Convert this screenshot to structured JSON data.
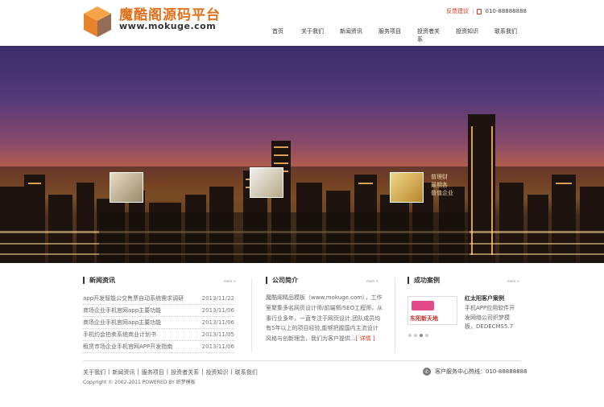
{
  "header": {
    "logo_title": "魔酷阁源码平台",
    "logo_url": "www.mokuge.com",
    "feedback": "反馈建议",
    "phone": "010-88888888",
    "nav": [
      "首页",
      "关于我们",
      "新闻资讯",
      "服务项目",
      "投资者关系",
      "投资知识",
      "联系我们"
    ]
  },
  "banner": {
    "side_text": [
      "普理财",
      "最期各",
      "普值企业"
    ]
  },
  "news": {
    "title": "新闻资讯",
    "more": "more +",
    "items": [
      {
        "text": "app开发智能公交售票自动系统需求调研",
        "date": "2013/11/22"
      },
      {
        "text": "商场企业手机官网app主要功能",
        "date": "2013/11/06"
      },
      {
        "text": "商场企业手机官网app主要功能",
        "date": "2013/11/06"
      },
      {
        "text": "手机约会拍卖系统商业计划书",
        "date": "2013/11/05"
      },
      {
        "text": "租赁市场企业手机官网APP开发指南",
        "date": "2013/11/06"
      }
    ]
  },
  "about": {
    "title": "公司简介",
    "more": "more +",
    "text": "魔酷阁精品模板（www.mokuge.com），工作室聚集多名网页设计师/前端师/SEO工程师，从事行业多年，一直专注于网页设计,团队成员均有5年以上的项目经验,能够把握国内主流设计风格与创新理念，我们为客户提供...",
    "detail": "[ 详情 ]"
  },
  "cases": {
    "title": "成功案例",
    "more": "more +",
    "case_title": "红太阳客户案例",
    "case_desc": "手机APP应用软件开发网络公司织梦模板，DEDECMS5.7",
    "img_text": "东阳新天地"
  },
  "footer": {
    "links": [
      "关于我们",
      "新闻资讯",
      "服务项目",
      "投资者关系",
      "投资知识",
      "联系我们"
    ],
    "copyright": "Copyright © 2002-2011 POWERED BY 织梦模板",
    "hotline": "客户服务中心热线：010-88888888"
  },
  "colors": {
    "accent": "#e0701a",
    "link_red": "#d03a1a"
  }
}
